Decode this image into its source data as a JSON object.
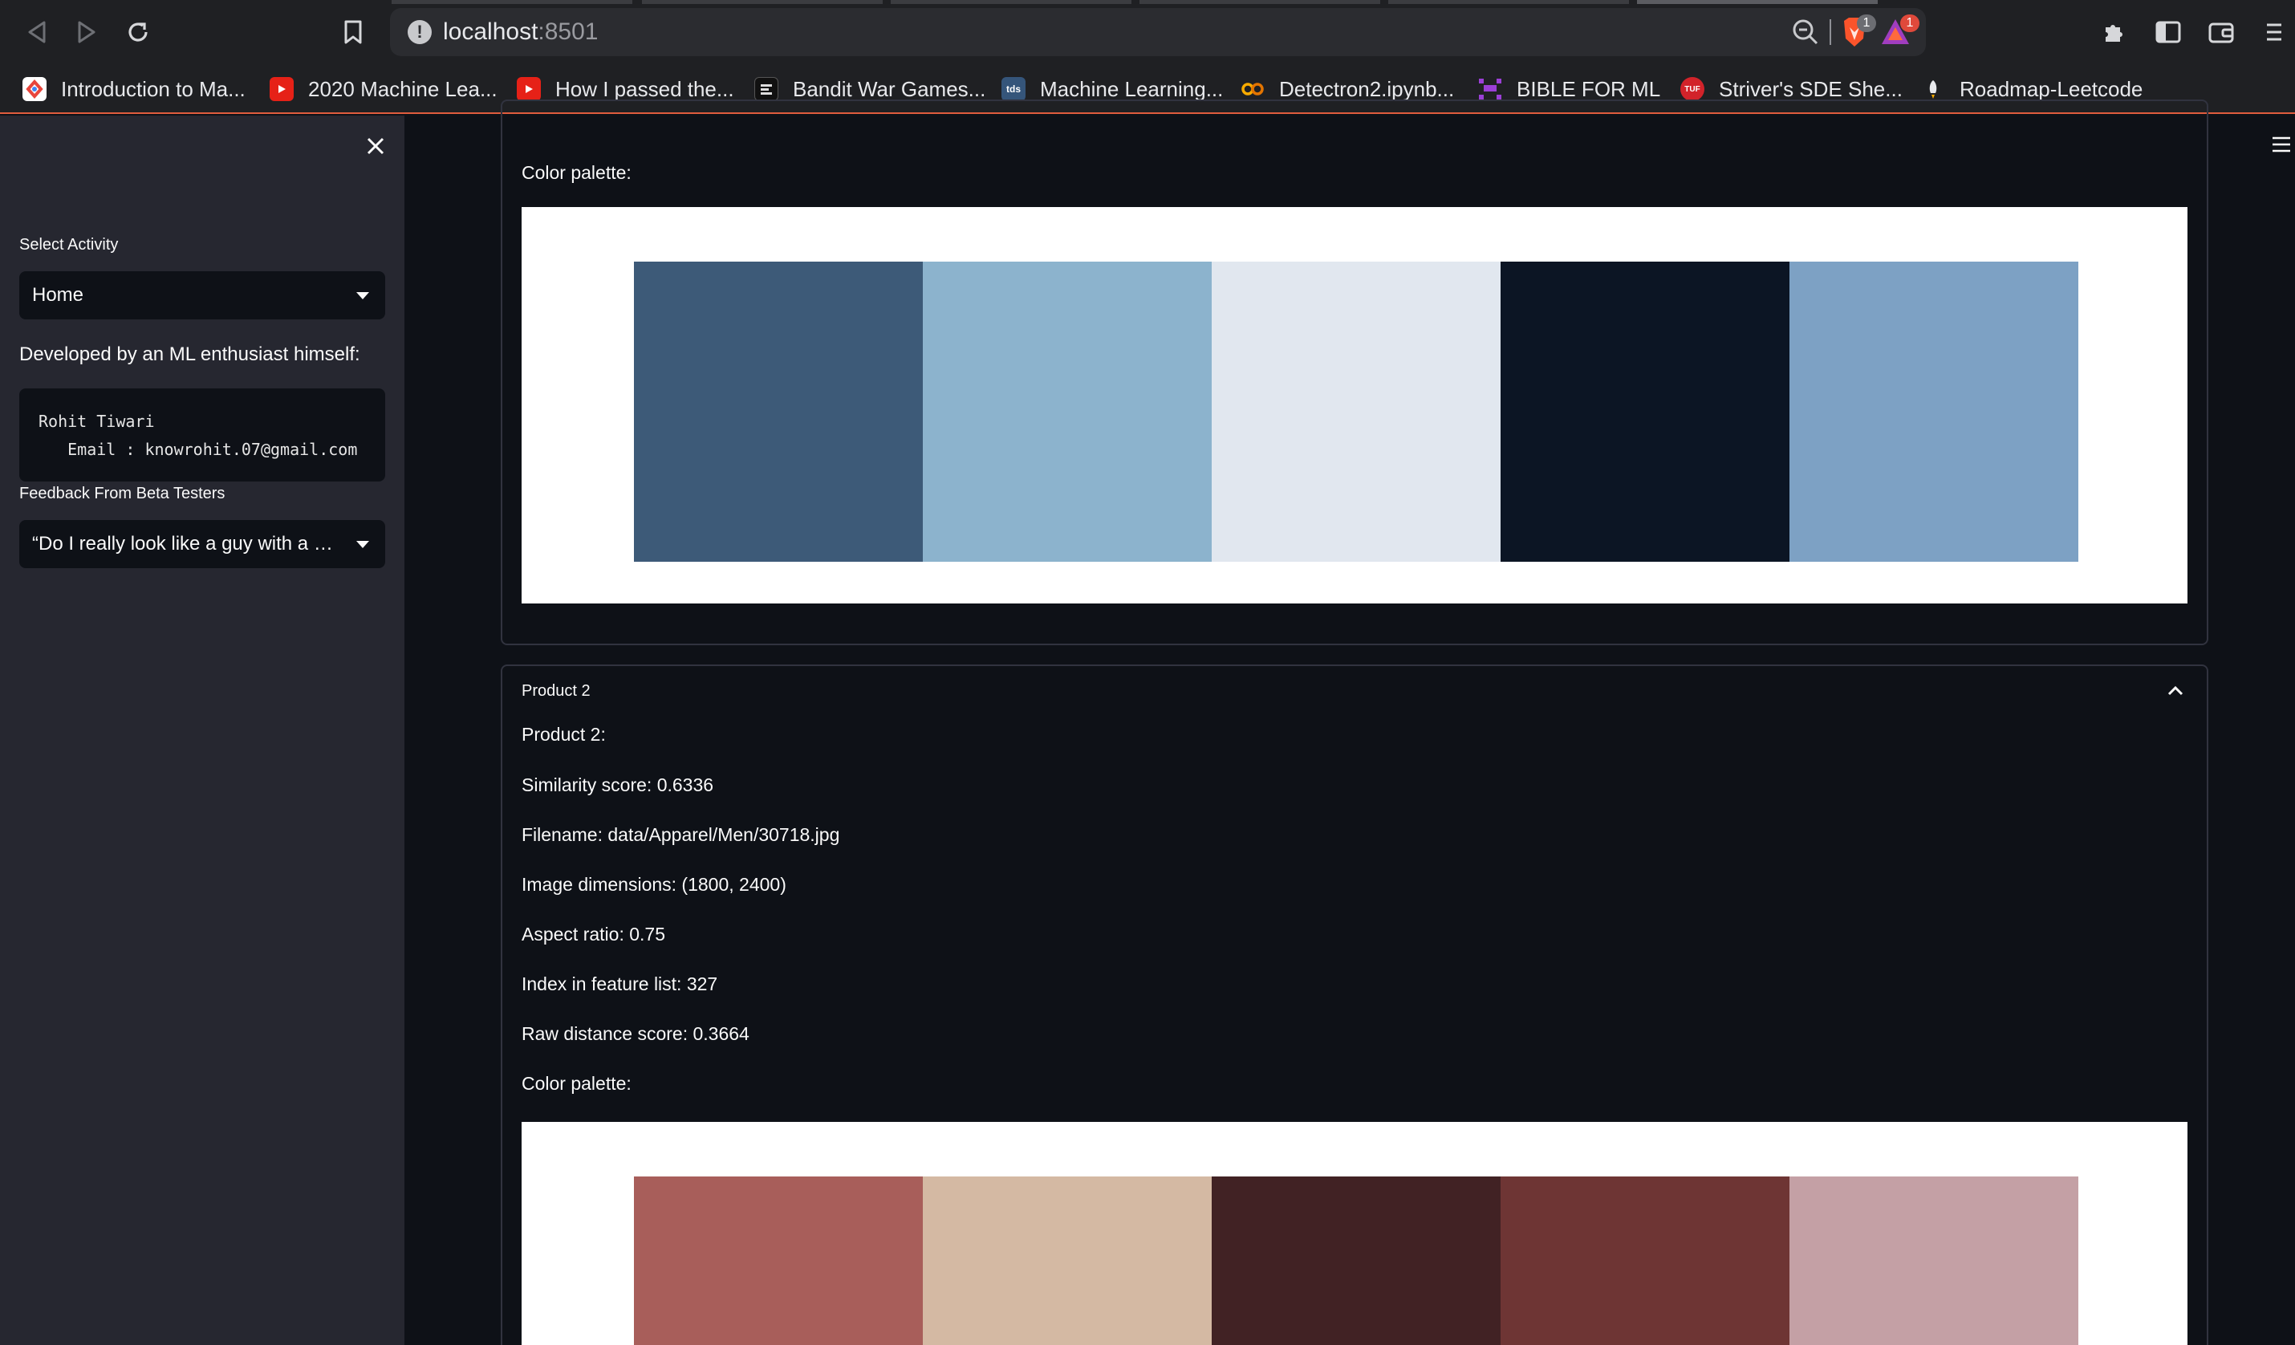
{
  "browser": {
    "url_host": "localhost",
    "url_port": ":8501",
    "shields_badge": "1",
    "rewards_badge": "1",
    "bookmarks": [
      {
        "label": "Introduction to Ma...",
        "icon": "colab-icon",
        "color": "#ffffff"
      },
      {
        "label": "2020 Machine Lea...",
        "icon": "youtube-icon",
        "color": "#e62117"
      },
      {
        "label": "How I passed the...",
        "icon": "youtube-icon",
        "color": "#e62117"
      },
      {
        "label": "Bandit War Games...",
        "icon": "overthewire-icon",
        "color": "#111111"
      },
      {
        "label": "Machine Learning...",
        "icon": "tds-icon",
        "color": "#35557a"
      },
      {
        "label": "Detectron2.ipynb...",
        "icon": "colab-infinity-icon",
        "color": "#f9ab00"
      },
      {
        "label": "BIBLE FOR ML",
        "icon": "pixel-icon",
        "color": "#9b3fd6"
      },
      {
        "label": "Striver's SDE She...",
        "icon": "tuf-icon",
        "color": "#d2232a"
      },
      {
        "label": "Roadmap-Leetcode",
        "icon": "rocket-icon",
        "color": "#e8e9ec"
      }
    ]
  },
  "sidebar": {
    "select_activity_label": "Select Activity",
    "select_activity_value": "Home",
    "developer_text": "Developed by an ML enthusiast himself:",
    "code_line1": "Rohit Tiwari",
    "code_line2": "   Email : knowrohit.07@gmail.com",
    "feedback_label": "Feedback From Beta Testers",
    "feedback_value": "“Do I really look like a guy with a plan”"
  },
  "main": {
    "prev_palette_label": "Color palette:",
    "prev_palette_colors": [
      "#3d5a78",
      "#8cb3cd",
      "#e1e7ef",
      "#0c1524",
      "#7da1c4"
    ],
    "product2": {
      "expander_title": "Product 2",
      "heading": "Product 2:",
      "similarity": "Similarity score: 0.6336",
      "filename": "Filename: data/Apparel/Men/30718.jpg",
      "dimensions": "Image dimensions: (1800, 2400)",
      "aspect": "Aspect ratio: 0.75",
      "index": "Index in feature list: 327",
      "raw_distance": "Raw distance score: 0.3664",
      "palette_label": "Color palette:",
      "palette_colors": [
        "#a85e5a",
        "#d4b9a3",
        "#412224",
        "#6e3534",
        "#c4a0a5"
      ]
    }
  }
}
